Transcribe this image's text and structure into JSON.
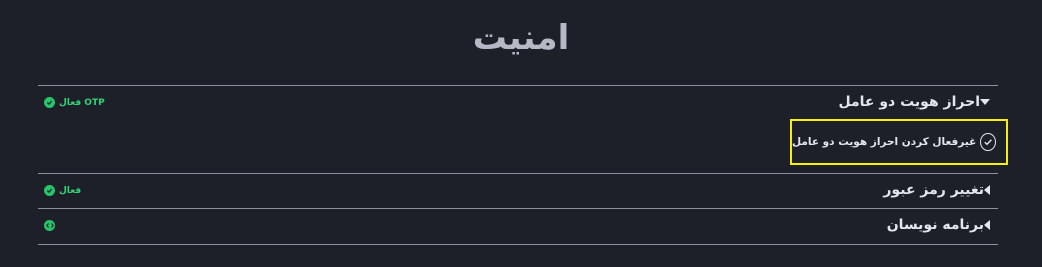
{
  "page": {
    "title": "امنیت"
  },
  "sections": [
    {
      "label": "احراز هویت دو عامل",
      "status_text": "OTP فعال",
      "option_label": "غیرفعال کردن احراز هویت دو عامل"
    },
    {
      "label": "تغییر رمز عبور",
      "status_text": "فعال"
    },
    {
      "label": "برنامه نویسان",
      "status_text": ""
    }
  ],
  "colors": {
    "accent_green": "#27c46a",
    "highlight": "#f5ef0c",
    "background": "#1e2029"
  },
  "icons": [
    "chevron-down-icon",
    "chevron-left-icon",
    "check-circle-icon",
    "status-check-icon",
    "code-icon"
  ]
}
